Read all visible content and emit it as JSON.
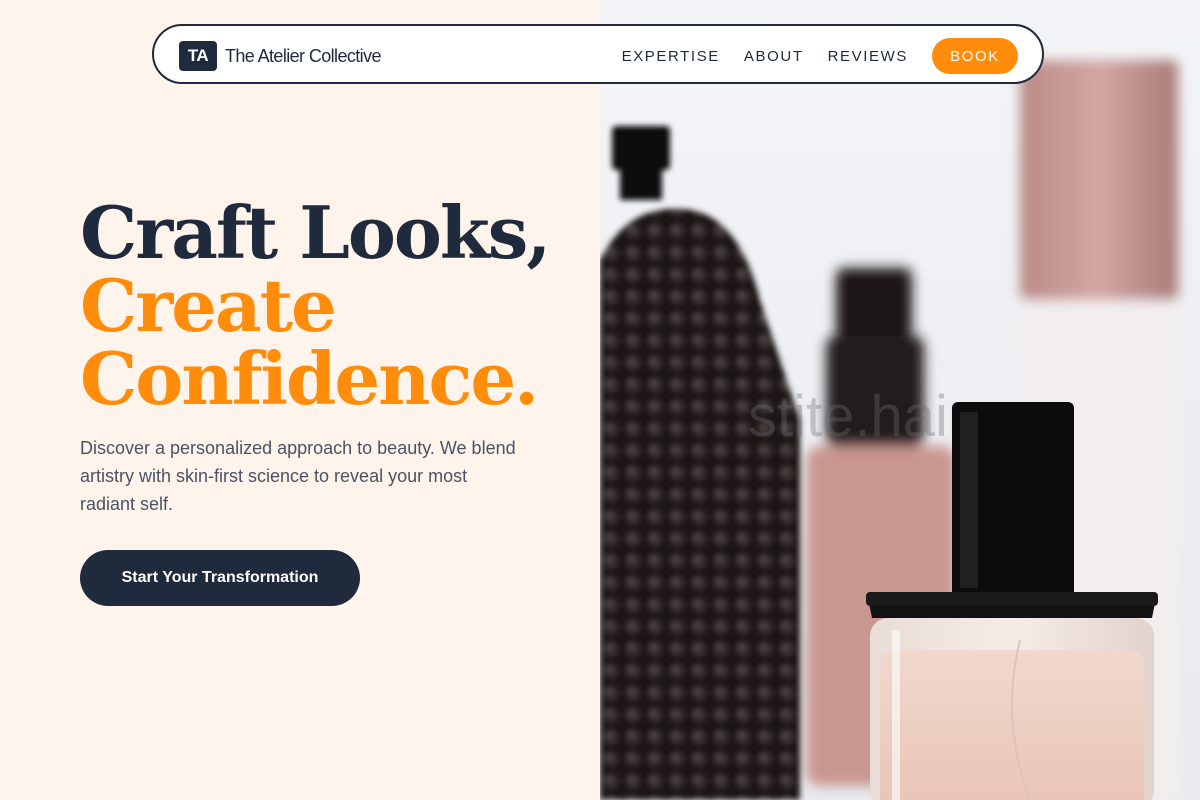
{
  "brand": {
    "mark": "TA",
    "name": "The Atelier Collective"
  },
  "nav": {
    "links": [
      "EXPERTISE",
      "ABOUT",
      "REVIEWS"
    ],
    "book_label": "BOOK"
  },
  "hero": {
    "line1": "Craft Looks,",
    "line2": "Create",
    "line3": "Confidence.",
    "description": "Discover a personalized approach to beauty. We blend artistry with skin-first science to reveal your most radiant self.",
    "cta_label": "Start Your Transformation"
  },
  "image": {
    "watermark": "stite.hair"
  },
  "colors": {
    "navy": "#1f2a3c",
    "accent": "#ff8c0a",
    "cream": "#fff4ec"
  }
}
